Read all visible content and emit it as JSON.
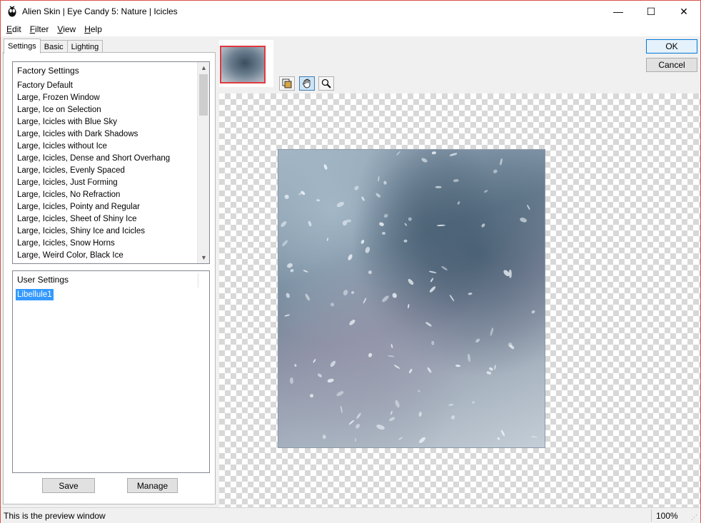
{
  "window": {
    "title": "Alien Skin | Eye Candy 5: Nature | Icicles",
    "minimize": "—",
    "maximize": "☐",
    "close": "✕"
  },
  "menu": [
    {
      "underline": "E",
      "rest": "dit"
    },
    {
      "underline": "F",
      "rest": "ilter"
    },
    {
      "underline": "V",
      "rest": "iew"
    },
    {
      "underline": "H",
      "rest": "elp"
    }
  ],
  "tabs": [
    "Settings",
    "Basic",
    "Lighting"
  ],
  "factory": {
    "header": "Factory Settings",
    "items": [
      "Factory Default",
      "Large, Frozen Window",
      "Large, Ice on Selection",
      "Large, Icicles with Blue Sky",
      "Large, Icicles with Dark Shadows",
      "Large, Icicles without Ice",
      "Large, Icicles, Dense and Short Overhang",
      "Large, Icicles, Evenly Spaced",
      "Large, Icicles, Just Forming",
      "Large, Icicles, No Refraction",
      "Large, Icicles, Pointy and Regular",
      "Large, Icicles, Sheet of Shiny Ice",
      "Large, Icicles, Shiny Ice and Icicles",
      "Large, Icicles, Snow Horns",
      "Large, Weird Color, Black Ice"
    ]
  },
  "user": {
    "header": "User Settings",
    "selected": "Libellule1"
  },
  "buttons": {
    "save": "Save",
    "manage": "Manage",
    "ok": "OK",
    "cancel": "Cancel"
  },
  "tools": {
    "navigator_icon": "navigator-icon",
    "hand_icon": "hand-icon",
    "zoom_icon": "zoom-icon"
  },
  "status": {
    "text": "This is the preview window",
    "zoom": "100%"
  }
}
